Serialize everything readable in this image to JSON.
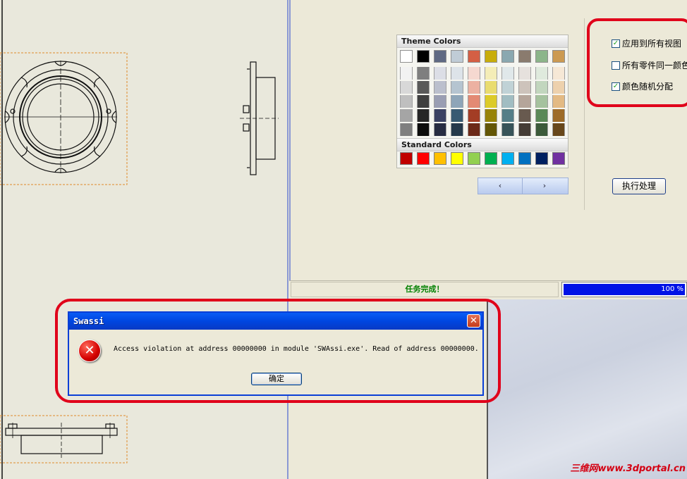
{
  "palette": {
    "theme_header": "Theme Colors",
    "standard_header": "Standard Colors",
    "theme_top": [
      "#ffffff",
      "#000000",
      "#5f6983",
      "#c0ccd6",
      "#d45f44",
      "#c8ad0a",
      "#8aa8b0",
      "#8a7b6e",
      "#8cb58a",
      "#cc9a52"
    ],
    "theme_shades": [
      [
        "#f2f2f2",
        "#7f7f7f",
        "#dcdee6",
        "#dde3e9",
        "#f5d8d0",
        "#f4edb7",
        "#e0e8ea",
        "#e6e1dd",
        "#dfeadd",
        "#f6e8d6"
      ],
      [
        "#d8d8d8",
        "#595959",
        "#bbbfcd",
        "#b5c4d0",
        "#ecb1a2",
        "#e9dc6f",
        "#c0d2d6",
        "#cdc3bb",
        "#c2d6be",
        "#edd1ad"
      ],
      [
        "#bfbfbf",
        "#3f3f3f",
        "#9a9eb3",
        "#8ea5b8",
        "#e38a74",
        "#dccb28",
        "#a1bdc2",
        "#b5a59a",
        "#a5c29e",
        "#e3ba84"
      ],
      [
        "#a5a5a5",
        "#262626",
        "#3b4263",
        "#385a72",
        "#a33d25",
        "#978307",
        "#557e87",
        "#685a4f",
        "#5a8857",
        "#9d6b29"
      ],
      [
        "#7f7f7f",
        "#0c0c0c",
        "#272c42",
        "#25394b",
        "#6c2918",
        "#645705",
        "#385459",
        "#453c35",
        "#3c5a3a",
        "#68471b"
      ]
    ],
    "standard": [
      "#c00000",
      "#ff0000",
      "#ffc000",
      "#ffff00",
      "#92d050",
      "#00b050",
      "#00b0f0",
      "#0070c0",
      "#002060",
      "#7030a0"
    ]
  },
  "pager": {
    "prev": "‹",
    "next": "›"
  },
  "options": {
    "items": [
      {
        "label": "应用到所有视图",
        "checked": true,
        "mark": "✓"
      },
      {
        "label": "所有零件同一颜色",
        "checked": false,
        "mark": ""
      },
      {
        "label": "颜色随机分配",
        "checked": true,
        "mark": "✓"
      }
    ],
    "execute_label": "执行处理"
  },
  "status": {
    "text": "任务完成！",
    "progress_percent": 100,
    "progress_text": "100 %"
  },
  "dialog": {
    "title": "Swassi",
    "close_glyph": "✕",
    "icon_glyph": "✕",
    "message": "Access violation at address 00000000 in module 'SWAssi.exe'. Read of address 00000000.",
    "ok_label": "确定"
  },
  "watermark": "三维网www.3dportal.cn",
  "colors": {
    "highlight_ring": "#e0001a",
    "title_bar": "#0a5cf5",
    "progress": "#0012e6"
  }
}
